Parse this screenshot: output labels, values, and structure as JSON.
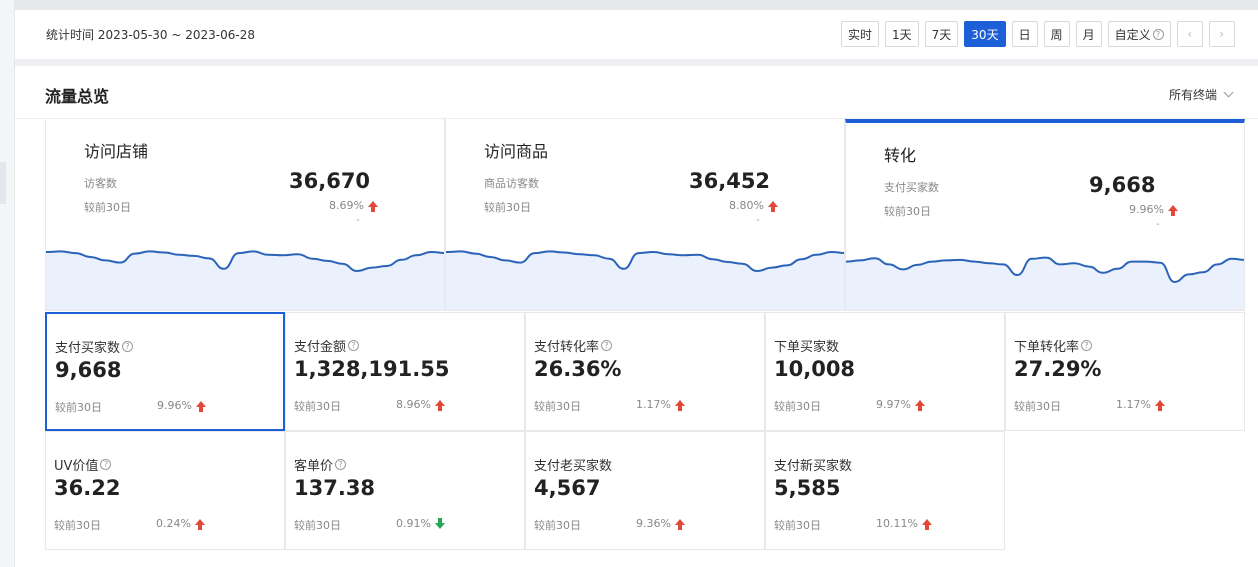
{
  "date_range": {
    "label": "统计时间 2023-05-30 ~ 2023-06-28"
  },
  "date_buttons": [
    {
      "label": "实时",
      "active": false
    },
    {
      "label": "1天",
      "active": false
    },
    {
      "label": "7天",
      "active": false
    },
    {
      "label": "30天",
      "active": true
    },
    {
      "label": "日",
      "active": false
    },
    {
      "label": "周",
      "active": false
    },
    {
      "label": "月",
      "active": false
    },
    {
      "label": "自定义",
      "active": false
    }
  ],
  "nav": {
    "prev": "‹",
    "next": "›"
  },
  "panel": {
    "title": "流量总览",
    "terminal": "所有终端"
  },
  "funnel": [
    {
      "title": "访问店铺",
      "label": "访客数",
      "value": "36,670",
      "compare": "较前30日",
      "pct": "8.69%",
      "trend": "up",
      "dash": "-",
      "selected": false,
      "trend_series": [
        0.32,
        0.3,
        0.36,
        0.5,
        0.62,
        0.7,
        0.38,
        0.3,
        0.34,
        0.42,
        0.46,
        0.55,
        0.92,
        0.36,
        0.3,
        0.42,
        0.44,
        0.4,
        0.56,
        0.64,
        0.74,
        1.0,
        0.88,
        0.82,
        0.6,
        0.44,
        0.32,
        0.36
      ]
    },
    {
      "title": "访问商品",
      "label": "商品访客数",
      "value": "36,452",
      "compare": "较前30日",
      "pct": "8.80%",
      "trend": "up",
      "dash": "-",
      "selected": false,
      "trend_series": [
        0.32,
        0.3,
        0.38,
        0.5,
        0.62,
        0.7,
        0.36,
        0.3,
        0.34,
        0.4,
        0.44,
        0.56,
        0.92,
        0.36,
        0.32,
        0.4,
        0.44,
        0.42,
        0.58,
        0.68,
        0.74,
        1.0,
        0.88,
        0.8,
        0.58,
        0.42,
        0.32,
        0.36
      ]
    },
    {
      "title": "转化",
      "label": "支付买家数",
      "value": "9,668",
      "compare": "较前30日",
      "pct": "9.96%",
      "trend": "up",
      "dash": "-",
      "selected": true,
      "trend_series": [
        0.52,
        0.48,
        0.4,
        0.62,
        0.8,
        0.64,
        0.52,
        0.48,
        0.46,
        0.52,
        0.58,
        0.62,
        1.0,
        0.42,
        0.38,
        0.62,
        0.58,
        0.7,
        0.92,
        0.78,
        0.52,
        0.52,
        0.56,
        1.25,
        0.98,
        0.9,
        0.62,
        0.42,
        0.46
      ]
    }
  ],
  "metrics": [
    {
      "label": "支付买家数",
      "help": true,
      "value": "9,668",
      "compare": "较前30日",
      "pct": "9.96%",
      "trend": "up",
      "selected": true
    },
    {
      "label": "支付金额",
      "help": true,
      "value": "1,328,191.55",
      "compare": "较前30日",
      "pct": "8.96%",
      "trend": "up",
      "selected": false
    },
    {
      "label": "支付转化率",
      "help": true,
      "value": "26.36%",
      "compare": "较前30日",
      "pct": "1.17%",
      "trend": "up",
      "selected": false
    },
    {
      "label": "下单买家数",
      "help": false,
      "value": "10,008",
      "compare": "较前30日",
      "pct": "9.97%",
      "trend": "up",
      "selected": false
    },
    {
      "label": "下单转化率",
      "help": true,
      "value": "27.29%",
      "compare": "较前30日",
      "pct": "1.17%",
      "trend": "up",
      "selected": false
    },
    {
      "label": "UV价值",
      "help": true,
      "value": "36.22",
      "compare": "较前30日",
      "pct": "0.24%",
      "trend": "up",
      "selected": false
    },
    {
      "label": "客单价",
      "help": true,
      "value": "137.38",
      "compare": "较前30日",
      "pct": "0.91%",
      "trend": "down",
      "selected": false
    },
    {
      "label": "支付老买家数",
      "help": false,
      "value": "4,567",
      "compare": "较前30日",
      "pct": "9.36%",
      "trend": "up",
      "selected": false
    },
    {
      "label": "支付新买家数",
      "help": false,
      "value": "5,585",
      "compare": "较前30日",
      "pct": "10.11%",
      "trend": "up",
      "selected": false
    }
  ],
  "colors": {
    "accent": "#1d5fd6",
    "up": "#e3493b",
    "down": "#27a658",
    "spark_fill": "#eaf1fc",
    "spark_line": "#2b63b8"
  }
}
